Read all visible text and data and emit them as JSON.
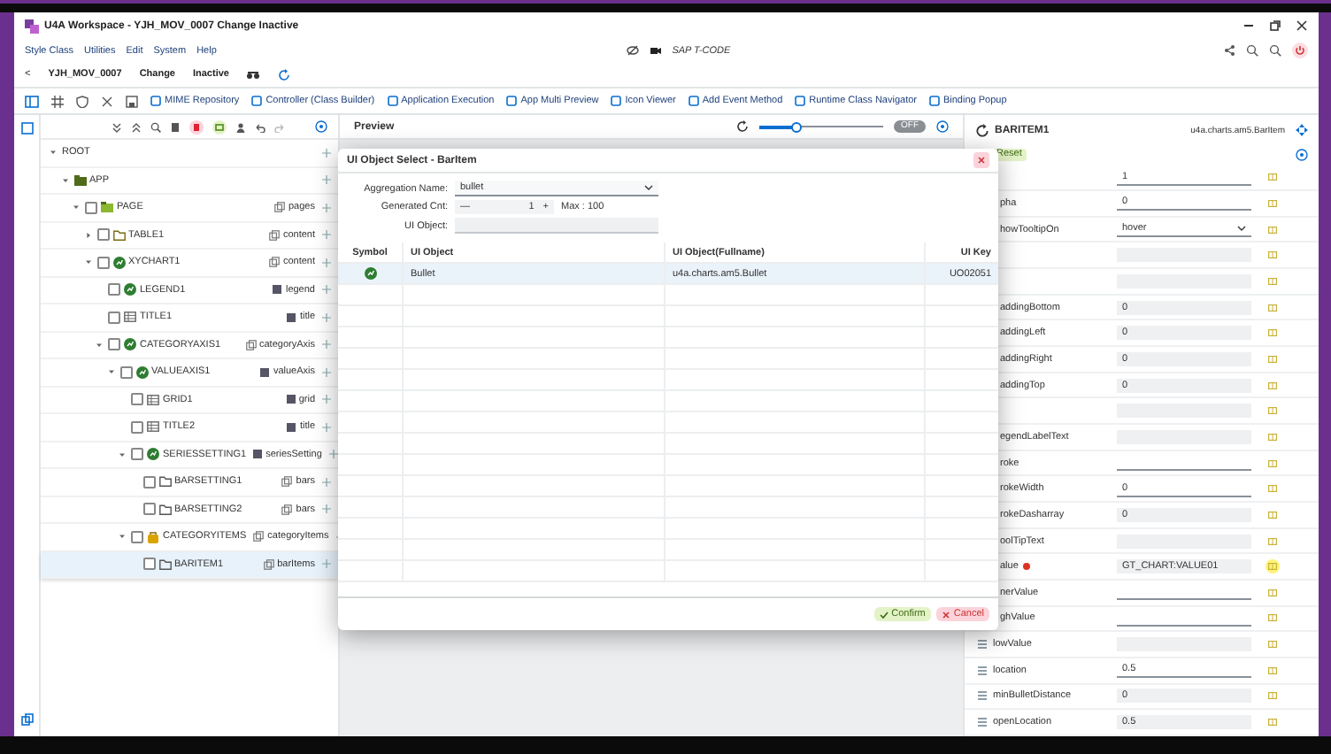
{
  "window": {
    "title": "U4A Workspace - YJH_MOV_0007 Change Inactive"
  },
  "menu": [
    "Style Class",
    "Utilities",
    "Edit",
    "System",
    "Help"
  ],
  "tcode": {
    "placeholder": "SAP T-CODE"
  },
  "app_bar": {
    "back": "<",
    "app_id": "YJH_MOV_0007",
    "mode": "Change",
    "status": "Inactive"
  },
  "toolbar": [
    "MIME Repository",
    "Controller (Class Builder)",
    "Application Execution",
    "App Multi Preview",
    "Icon Viewer",
    "Add Event Method",
    "Runtime Class Navigator",
    "Binding Popup"
  ],
  "tree": [
    {
      "label": "ROOT",
      "expanded": true,
      "selected": false,
      "children": [
        {
          "label": "APP",
          "kind": "app",
          "expanded": true,
          "selected": false,
          "children": [
            {
              "label": "PAGE",
              "kind": "page",
              "agg": "pages",
              "agg_multiple": true,
              "checked": false,
              "expanded": true,
              "selected": false,
              "children": [
                {
                  "label": "TABLE1",
                  "kind": "folder",
                  "agg": "content",
                  "agg_multiple": true,
                  "checked": false,
                  "expanded": false,
                  "selected": false
                },
                {
                  "label": "XYCHART1",
                  "kind": "chart",
                  "agg": "content",
                  "agg_multiple": true,
                  "checked": false,
                  "expanded": true,
                  "selected": false,
                  "children": [
                    {
                      "label": "LEGEND1",
                      "kind": "chart",
                      "agg": "legend",
                      "agg_multiple": false,
                      "checked": false,
                      "selected": false
                    },
                    {
                      "label": "TITLE1",
                      "kind": "grid",
                      "agg": "title",
                      "agg_multiple": false,
                      "checked": false,
                      "selected": false
                    },
                    {
                      "label": "CATEGORYAXIS1",
                      "kind": "chart",
                      "agg": "categoryAxis",
                      "agg_multiple": true,
                      "checked": false,
                      "expanded": true,
                      "selected": false,
                      "children": [
                        {
                          "label": "VALUEAXIS1",
                          "kind": "chart",
                          "agg": "valueAxis",
                          "agg_multiple": false,
                          "checked": false,
                          "expanded": true,
                          "selected": false,
                          "children": [
                            {
                              "label": "GRID1",
                              "kind": "grid",
                              "agg": "grid",
                              "agg_multiple": false,
                              "checked": false,
                              "selected": false
                            },
                            {
                              "label": "TITLE2",
                              "kind": "grid",
                              "agg": "title",
                              "agg_multiple": false,
                              "checked": false,
                              "selected": false
                            },
                            {
                              "label": "SERIESSETTING1",
                              "kind": "chart",
                              "agg": "seriesSetting",
                              "agg_multiple": false,
                              "checked": false,
                              "expanded": true,
                              "selected": false,
                              "children": [
                                {
                                  "label": "BARSETTING1",
                                  "kind": "outline",
                                  "agg": "bars",
                                  "agg_multiple": true,
                                  "checked": false,
                                  "selected": false
                                },
                                {
                                  "label": "BARSETTING2",
                                  "kind": "outline",
                                  "agg": "bars",
                                  "agg_multiple": true,
                                  "checked": false,
                                  "selected": false
                                }
                              ]
                            },
                            {
                              "label": "CATEGORYITEMS",
                              "kind": "item",
                              "agg": "categoryItems",
                              "agg_multiple": true,
                              "checked": false,
                              "expanded": true,
                              "selected": false,
                              "children": [
                                {
                                  "label": "BARITEM1",
                                  "kind": "outline",
                                  "agg": "barItems",
                                  "agg_multiple": true,
                                  "checked": false,
                                  "selected": true
                                }
                              ]
                            }
                          ]
                        }
                      ]
                    }
                  ]
                }
              ]
            }
          ]
        }
      ]
    }
  ],
  "preview": {
    "title": "Preview",
    "level": 0.3,
    "toggle": "OFF",
    "toggle_on": false
  },
  "props": {
    "object": "BARITEM1",
    "class": "u4a.charts.am5.BarItem",
    "reset": "Reset",
    "rows": [
      {
        "label": "",
        "value": "1",
        "kind": "input",
        "bound": false
      },
      {
        "label": "pha",
        "value": "0",
        "kind": "input",
        "bound": false
      },
      {
        "label": "howTooltipOn",
        "value": "hover",
        "kind": "select",
        "bound": false
      },
      {
        "label": "",
        "value": "",
        "kind": "readonly",
        "bound": false
      },
      {
        "label": "",
        "value": "",
        "kind": "readonly",
        "bound": false
      },
      {
        "label": "addingBottom",
        "value": "0",
        "kind": "readonly",
        "bound": false
      },
      {
        "label": "addingLeft",
        "value": "0",
        "kind": "readonly",
        "bound": false
      },
      {
        "label": "addingRight",
        "value": "0",
        "kind": "readonly",
        "bound": false
      },
      {
        "label": "addingTop",
        "value": "0",
        "kind": "readonly",
        "bound": false
      },
      {
        "label": "",
        "value": "",
        "kind": "readonly",
        "bound": false
      },
      {
        "label": "egendLabelText",
        "value": "",
        "kind": "readonly",
        "bound": false
      },
      {
        "label": "roke",
        "value": "",
        "kind": "input",
        "bound": false
      },
      {
        "label": "rokeWidth",
        "value": "0",
        "kind": "input",
        "bound": false
      },
      {
        "label": "rokeDasharray",
        "value": "0",
        "kind": "readonly",
        "bound": false
      },
      {
        "label": "oolTipText",
        "value": "",
        "kind": "readonly",
        "bound": false
      },
      {
        "label": "alue",
        "value": "GT_CHART:VALUE01",
        "kind": "readonly",
        "required": true,
        "bound": true
      },
      {
        "label": "nerValue",
        "value": "",
        "kind": "input",
        "bound": false
      },
      {
        "label": "ghValue",
        "value": "",
        "kind": "input",
        "bound": false
      },
      {
        "label": "lowValue",
        "value": "",
        "kind": "readonly",
        "bound": false,
        "icon": true
      },
      {
        "label": "location",
        "value": "0.5",
        "kind": "input",
        "bound": false,
        "icon": true
      },
      {
        "label": "minBulletDistance",
        "value": "0",
        "kind": "readonly",
        "bound": false,
        "icon": true
      },
      {
        "label": "openLocation",
        "value": "0.5",
        "kind": "readonly",
        "bound": false,
        "icon": true
      }
    ]
  },
  "dialog": {
    "title": "UI Object Select - BarItem",
    "aggregation_label": "Aggregation Name:",
    "aggregation_value": "bullet",
    "cnt_label": "Generated Cnt:",
    "cnt_minus": "—",
    "cnt_value": "1",
    "cnt_plus": "+",
    "cnt_max": "Max : 100",
    "object_label": "UI Object:",
    "columns": [
      "Symbol",
      "UI Object",
      "UI Object(Fullname)",
      "UI Key"
    ],
    "rows": [
      {
        "ui_object": "Bullet",
        "fullname": "u4a.charts.am5.Bullet",
        "key": "UO02051",
        "selected": true
      }
    ],
    "confirm": "Confirm",
    "cancel": "Cancel"
  }
}
